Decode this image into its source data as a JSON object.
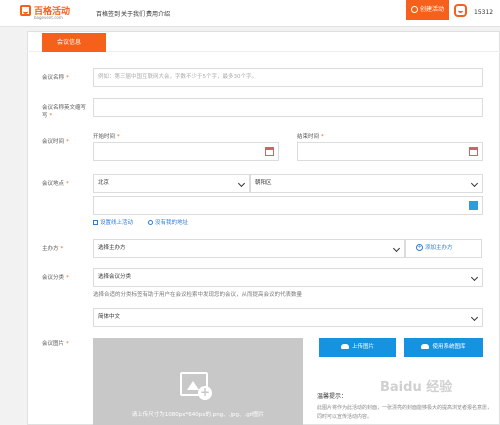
{
  "header": {
    "logo_text": "百格活动",
    "logo_sub": "bagevent.com",
    "nav": [
      "百格签到",
      "关于我们",
      "费用介绍"
    ],
    "create_label": "创建活动",
    "phone": "15312"
  },
  "section_tab": "会议信息",
  "form": {
    "name_label": "会议名称",
    "name_placeholder": "例如：第三届中国互联网大会，字数不少于5个字，最多30个字。",
    "english_label": "会议名称英文缩写",
    "english_label_2": "写",
    "time_label": "会议时间",
    "start_label": "开始时间",
    "end_label": "结束时间",
    "location_label": "会议地点",
    "city": "北京",
    "district": "朝阳区",
    "online_link": "设置线上活动",
    "no_address_link": "没有我的地址",
    "host_label": "主办方",
    "host_select": "选择主办方",
    "add_host": "添加主办方",
    "category_label": "会议分类",
    "category_select": "选择会议分类",
    "category_hint": "选择合适的分类标签有助于用户在会议检索中发现您的会议，从而提高会议的代表数量",
    "language_select": "简体中文",
    "image_label": "会议图片",
    "upload_caption": "请上传尺寸为1080px*640px的.png、.jpg、.gif图片",
    "upload_button": "上传图片",
    "system_image_button": "使用系统图库",
    "tip_title": "温馨提示：",
    "tip_body": "此图片将作为此活动的封面，一张漂亮的封面能够极大的提高浏览者报名意愿，同时可以宣传活动内容。"
  },
  "required_mark": "*",
  "watermark": "Baidu 经验",
  "colors": {
    "brand": "#f5601a",
    "blue": "#1593e0",
    "link": "#2e7cd6"
  }
}
